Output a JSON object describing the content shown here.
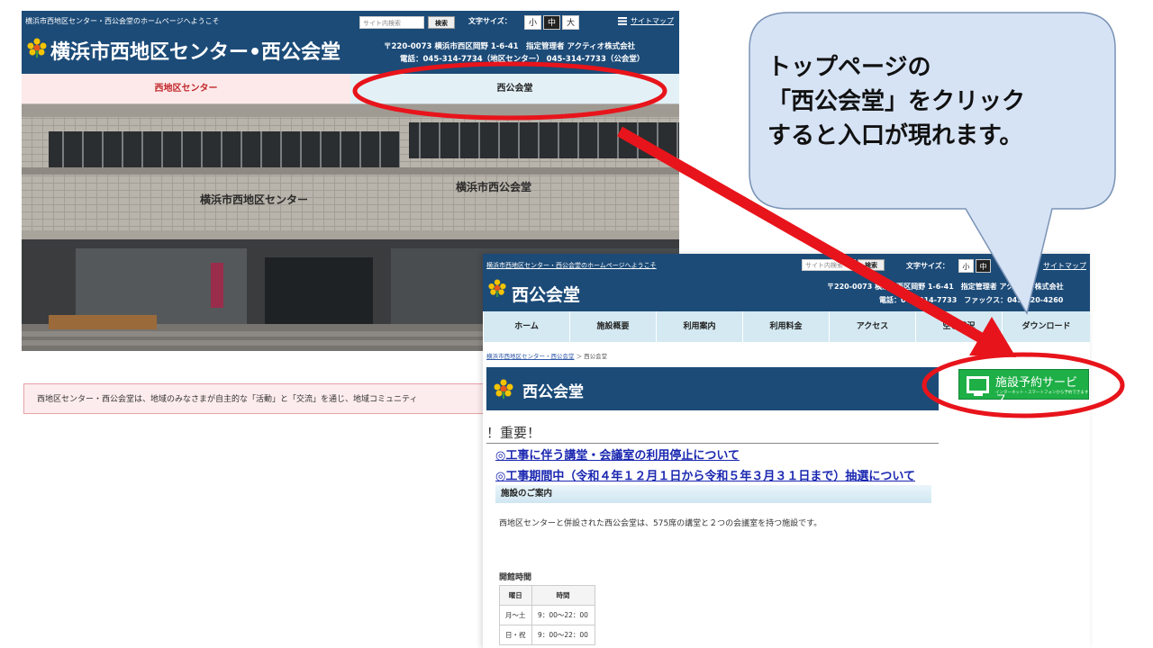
{
  "top_page": {
    "welcome": "横浜市西地区センター・西公会堂のホームページへようこそ",
    "search_placeholder": "サイト内検索",
    "search_button": "検索",
    "font_size_label": "文字サイズ：",
    "font_sizes": [
      "小",
      "中",
      "大"
    ],
    "sitemap": "サイトマップ",
    "site_title": "横浜市西地区センター•西公会堂",
    "address": "〒220-0073 横浜市西区岡野 1-6-41　指定管理者 アクティオ株式会社",
    "phone": "電話：045-314-7734（地区センター） 045-314-7733（公会堂）",
    "tabs": [
      "西地区センター",
      "西公会堂"
    ],
    "photo_signs": [
      "横浜市西地区センター",
      "横浜市西公会堂"
    ],
    "notice": "西地区センター・西公会堂は、地域のみなさまが自主的な「活動」と「交流」を通じ、地域コミュニティ"
  },
  "hall_page": {
    "welcome": "横浜市西地区センター・西公会堂のホームページへようこそ",
    "search_placeholder": "サイト内検索",
    "search_button": "検索",
    "font_size_label": "文字サイズ：",
    "font_sizes": [
      "小",
      "中"
    ],
    "sitemap": "サイトマップ",
    "site_title": "西公会堂",
    "address": "〒220-0073 横浜市西区岡野 1-6-41　指定管理者 アクティオ株式会社",
    "phone": "電話：045-314-7733　ファックス：045-320-4260",
    "nav": [
      "ホーム",
      "施設概要",
      "利用案内",
      "利用料金",
      "アクセス",
      "空き状況",
      "ダウンロード"
    ],
    "breadcrumb_home": "横浜市西地区センター・西公会堂",
    "breadcrumb_sep": "＞",
    "breadcrumb_current": "西公会堂",
    "page_title": "西公会堂",
    "reserve_label": "施設予約サービス",
    "reserve_sub": "インターネット・スマートフォンから予約できます",
    "important": "！重要！",
    "links": [
      "◎工事に伴う講堂・会議室の利用停止について",
      "◎工事期間中（令和４年１２月１日から令和５年３月３１日まで）抽選について"
    ],
    "section_title": "施設のご案内",
    "description": "西地区センターと併設された西公会堂は、575席の講堂と２つの会議室を持つ施設です。",
    "hours_title": "開館時間",
    "hours_table": {
      "headers": [
        "曜日",
        "時間"
      ],
      "rows": [
        [
          "月～土",
          "9：00～22：00"
        ],
        [
          "日・祝",
          "9：00～22：00"
        ]
      ]
    }
  },
  "callout": {
    "lines": [
      "トップページの",
      "「西公会堂」をクリック",
      "すると入口が現れます。"
    ]
  },
  "colors": {
    "header_blue": "#1c4b78",
    "highlight_red": "#e8141b",
    "callout_fill": "#d6e3f5",
    "reserve_green": "#1eaf46"
  }
}
